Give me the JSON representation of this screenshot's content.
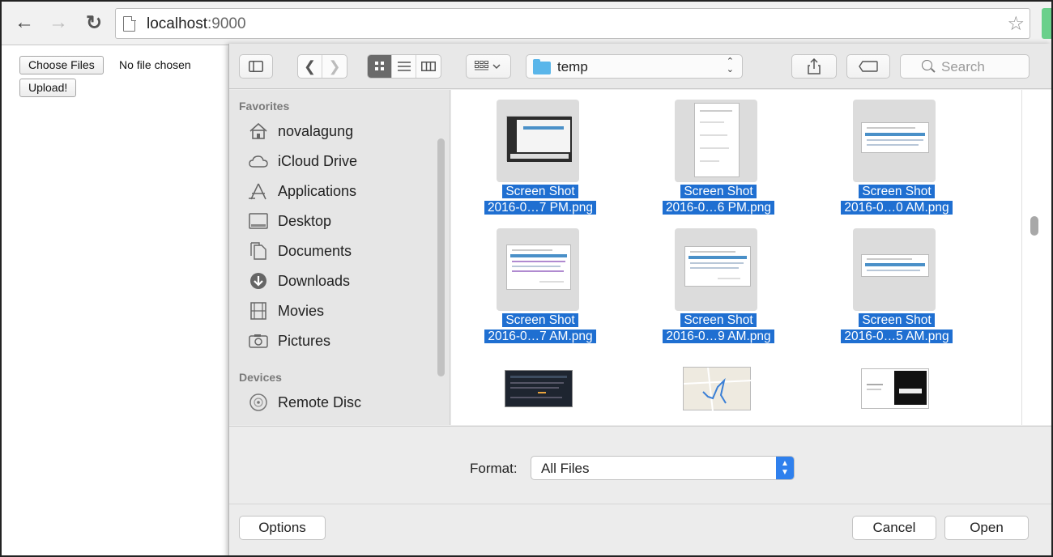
{
  "browser": {
    "url_host": "localhost",
    "url_port": ":9000",
    "back_icon": "back-arrow-icon",
    "forward_icon": "forward-arrow-icon",
    "reload_icon": "reload-icon",
    "star_icon": "bookmark-star-icon"
  },
  "page": {
    "choose_files_label": "Choose Files",
    "no_file_text": "No file chosen",
    "upload_label": "Upload!"
  },
  "dialog": {
    "folder": "temp",
    "search_placeholder": "Search",
    "sidebar": {
      "favorites_header": "Favorites",
      "favorites": [
        {
          "label": "novalagung",
          "icon": "home-icon"
        },
        {
          "label": "iCloud Drive",
          "icon": "cloud-icon"
        },
        {
          "label": "Applications",
          "icon": "applications-icon"
        },
        {
          "label": "Desktop",
          "icon": "desktop-icon"
        },
        {
          "label": "Documents",
          "icon": "documents-icon"
        },
        {
          "label": "Downloads",
          "icon": "downloads-icon"
        },
        {
          "label": "Movies",
          "icon": "movies-icon"
        },
        {
          "label": "Pictures",
          "icon": "pictures-icon"
        }
      ],
      "devices_header": "Devices",
      "devices": [
        {
          "label": "Remote Disc",
          "icon": "disc-icon"
        }
      ]
    },
    "files": [
      {
        "line1": "Screen Shot",
        "line2": "2016-0…7 PM.png"
      },
      {
        "line1": "Screen Shot",
        "line2": "2016-0…6 PM.png"
      },
      {
        "line1": "Screen Shot",
        "line2": "2016-0…0 AM.png"
      },
      {
        "line1": "Screen Shot",
        "line2": "2016-0…7 AM.png"
      },
      {
        "line1": "Screen Shot",
        "line2": "2016-0…9 AM.png"
      },
      {
        "line1": "Screen Shot",
        "line2": "2016-0…5 AM.png"
      }
    ],
    "format_label": "Format:",
    "format_value": "All Files",
    "options_label": "Options",
    "cancel_label": "Cancel",
    "open_label": "Open",
    "accent_color": "#1f6fd1",
    "folder_color": "#5ab6ea"
  }
}
